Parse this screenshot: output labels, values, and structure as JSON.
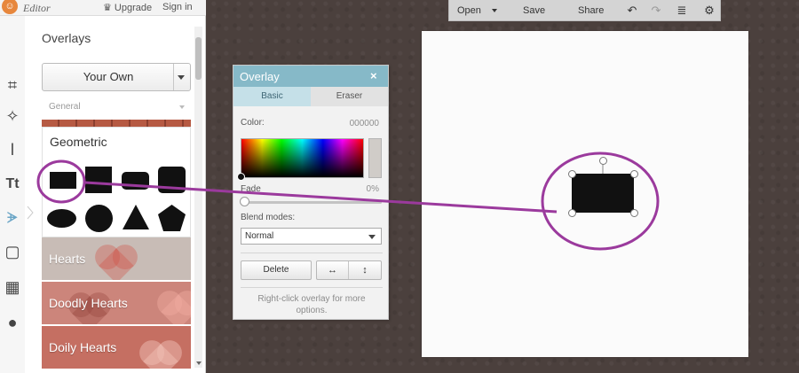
{
  "topbar": {
    "logo_glyph": "☺",
    "app_title": "Editor",
    "upgrade_label": "♛ Upgrade",
    "sign_in_label": "Sign in"
  },
  "tools": [
    {
      "icon": "crop-icon",
      "glyph": "⌗"
    },
    {
      "icon": "magic-wand-icon",
      "glyph": "✧"
    },
    {
      "icon": "brush-icon",
      "glyph": "ǀ"
    },
    {
      "icon": "text-icon",
      "glyph": "Tt"
    },
    {
      "icon": "butterfly-icon",
      "glyph": "ᗘ"
    },
    {
      "icon": "frame-icon",
      "glyph": "▢"
    },
    {
      "icon": "texture-icon",
      "glyph": "▦"
    },
    {
      "icon": "apple-icon",
      "glyph": "●"
    }
  ],
  "sidebar": {
    "heading": "Overlays",
    "your_own_label": "Your Own",
    "category_dropdown": "General",
    "geometric_title": "Geometric",
    "categories": [
      "Hearts",
      "Doodly Hearts",
      "Doily Hearts"
    ]
  },
  "toolbar": {
    "open_label": "Open",
    "save_label": "Save",
    "share_label": "Share",
    "undo_icon": "↶",
    "redo_icon": "↷",
    "layers_icon": "≣",
    "settings_icon": "⚙"
  },
  "overlay_dialog": {
    "title": "Overlay",
    "close_glyph": "×",
    "tabs": [
      "Basic",
      "Eraser"
    ],
    "color_label": "Color:",
    "color_value": "000000",
    "fade_label": "Fade",
    "fade_value": "0%",
    "blend_label": "Blend modes:",
    "blend_value": "Normal",
    "delete_label": "Delete",
    "flip_h_glyph": "↔",
    "flip_v_glyph": "↕",
    "hint": "Right-click overlay for more options."
  },
  "colors": {
    "accent_teal": "#86b9c8",
    "annotation_purple": "#9b3a9d",
    "canvas_bg": "#4b403d"
  }
}
